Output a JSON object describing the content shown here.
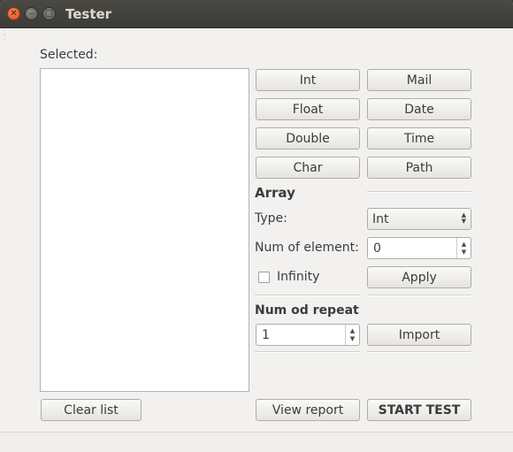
{
  "window": {
    "title": "Tester"
  },
  "selected": {
    "label": "Selected:",
    "items": []
  },
  "types": {
    "int": "Int",
    "mail": "Mail",
    "float": "Float",
    "date": "Date",
    "double": "Double",
    "time": "Time",
    "char": "Char",
    "path": "Path"
  },
  "array": {
    "heading": "Array",
    "type_label": "Type:",
    "type_value": "Int",
    "num_label": "Num of element:",
    "num_value": "0",
    "infinity_label": "Infinity",
    "infinity_checked": false,
    "apply": "Apply"
  },
  "repeat": {
    "heading": "Num od repeat",
    "value": "1",
    "import": "Import"
  },
  "footer": {
    "clear": "Clear list",
    "view_report": "View report",
    "start_test": "START TEST"
  }
}
